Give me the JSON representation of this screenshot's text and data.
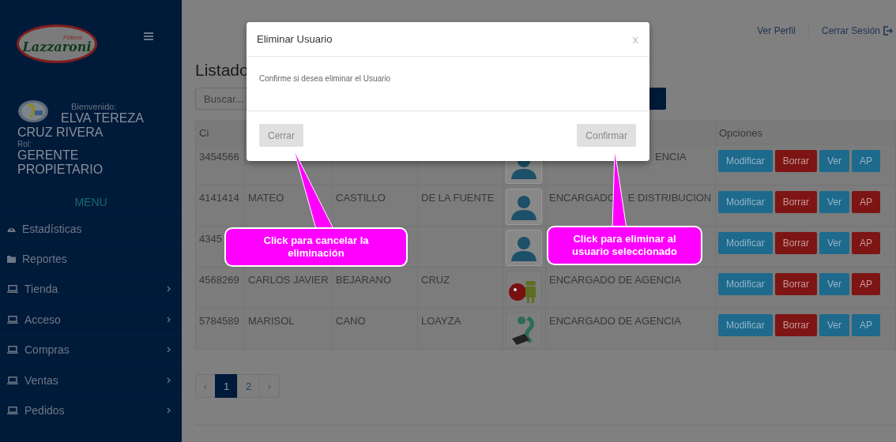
{
  "sidebar": {
    "logo": {
      "small": "Fideos",
      "brand": "Lazzaroni"
    },
    "user": {
      "greeting": "Bienvenido:",
      "name": [
        "ELVA TEREZA",
        "CRUZ RIVERA"
      ],
      "role_label": "Rol:",
      "role": "GERENTE PROPIETARIO"
    },
    "menu_title": "MENU",
    "items": [
      {
        "label": "Estadísticas",
        "kind": "dashboard",
        "has_submenu": false
      },
      {
        "label": "Reportes",
        "kind": "folder",
        "has_submenu": false
      },
      {
        "label": "Tienda",
        "kind": "laptop",
        "has_submenu": true
      },
      {
        "label": "Acceso",
        "kind": "laptop",
        "has_submenu": true
      },
      {
        "label": "Compras",
        "kind": "laptop",
        "has_submenu": true
      },
      {
        "label": "Ventas",
        "kind": "laptop",
        "has_submenu": true
      },
      {
        "label": "Pedidos",
        "kind": "laptop",
        "has_submenu": true
      }
    ]
  },
  "topbar": {
    "links": [
      "Ver Perfil",
      "Cerrar Sesión"
    ]
  },
  "heading": "Listado",
  "search": {
    "placeholder": "Buscar..."
  },
  "table": {
    "columns": {
      "column_1": "Ci",
      "column_7": "Opciones"
    },
    "rows": [
      {
        "ci": "3454566",
        "nombre": "",
        "paterno": "",
        "materno": "",
        "avatar": {
          "kind": "person"
        },
        "cargo": [
          "ENCIA"
        ],
        "cargo_partial": true,
        "buttons": [
          {
            "label": "Modificar",
            "kind": "primary"
          },
          {
            "label": "Borrar",
            "kind": "danger"
          },
          {
            "label": "Ver",
            "kind": "primary"
          },
          {
            "label": "AP",
            "kind": "primary"
          }
        ]
      },
      {
        "ci": "4141414",
        "nombre": "MATEO",
        "paterno": "CASTILLO",
        "materno": "DE LA FUENTE",
        "avatar": {
          "kind": "person"
        },
        "cargo": [
          "ENCARGADO",
          "E DISTRIBUCION"
        ],
        "cargo_partial": false,
        "buttons": [
          {
            "label": "Modificar",
            "kind": "primary"
          },
          {
            "label": "Borrar",
            "kind": "danger"
          },
          {
            "label": "Ver",
            "kind": "primary"
          },
          {
            "label": "AP",
            "kind": "danger"
          }
        ]
      },
      {
        "ci": "4345",
        "nombre": "",
        "paterno": "",
        "materno": "",
        "avatar": {
          "kind": "person"
        },
        "buttons": [
          {
            "label": "Modificar",
            "kind": "primary"
          },
          {
            "label": "Borrar",
            "kind": "danger"
          },
          {
            "label": "Ver",
            "kind": "primary"
          },
          {
            "label": "AP",
            "kind": "danger"
          }
        ]
      },
      {
        "ci": "4568269",
        "nombre": "CARLOS JAVIER",
        "paterno": "BEJARANO",
        "materno": "CRUZ",
        "avatar": {
          "kind": "android"
        },
        "cargo": [
          "ENCARGADO DE AGENCIA"
        ],
        "cargo_partial": false,
        "buttons": [
          {
            "label": "Modificar",
            "kind": "primary"
          },
          {
            "label": "Borrar",
            "kind": "danger"
          },
          {
            "label": "Ver",
            "kind": "primary"
          },
          {
            "label": "AP",
            "kind": "danger"
          }
        ]
      },
      {
        "ci": "5784589",
        "nombre": "MARISOL",
        "paterno": "CANO",
        "materno": "LOAYZA",
        "avatar": {
          "kind": "snake"
        },
        "cargo": [
          "ENCARGADO DE AGENCIA"
        ],
        "cargo_partial": false,
        "buttons": [
          {
            "label": "Modificar",
            "kind": "primary"
          },
          {
            "label": "Borrar",
            "kind": "danger"
          },
          {
            "label": "Ver",
            "kind": "primary"
          },
          {
            "label": "AP",
            "kind": "primary"
          }
        ]
      }
    ]
  },
  "pagination": {
    "prev": "‹",
    "next": "›",
    "pages": [
      {
        "label": "1",
        "selected": true
      },
      {
        "label": "2",
        "selected": false
      }
    ]
  },
  "modal": {
    "title": "Eliminar Usuario",
    "close": "x",
    "message": "Confirme si desea eliminar el Usuario",
    "buttons": [
      "Cerrar",
      "Confirmar"
    ]
  },
  "callouts": [
    "Click para cancelar la eliminación",
    "Click para eliminar al usuario seleccionado"
  ]
}
